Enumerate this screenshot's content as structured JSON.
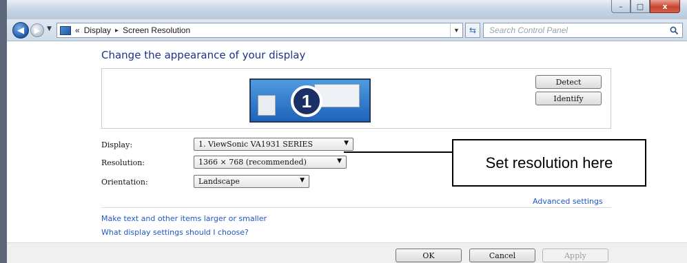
{
  "window": {
    "controls": {
      "minimize": "–",
      "maximize": "□",
      "close": "x"
    }
  },
  "nav": {
    "back_icon": "arrow-left-icon",
    "forward_icon": "arrow-right-icon",
    "breadcrumb_prefix": "«",
    "breadcrumb": [
      "Display",
      "Screen Resolution"
    ],
    "breadcrumb_separator": "▸",
    "search_placeholder": "Search Control Panel"
  },
  "page": {
    "title": "Change the appearance of your display",
    "monitor_number": "1",
    "detect_label": "Detect",
    "identify_label": "Identify"
  },
  "settings": {
    "display": {
      "label": "Display:",
      "value": "1. ViewSonic VA1931 SERIES"
    },
    "resolution": {
      "label": "Resolution:",
      "value": "1366 × 768 (recommended)"
    },
    "orientation": {
      "label": "Orientation:",
      "value": "Landscape"
    }
  },
  "callout": {
    "text": "Set resolution here"
  },
  "links": {
    "advanced": "Advanced settings",
    "text_size": "Make text and other items larger or smaller",
    "which_settings": "What display settings should I choose?"
  },
  "buttons": {
    "ok": "OK",
    "cancel": "Cancel",
    "apply": "Apply"
  },
  "colors": {
    "link": "#1f56c9",
    "title": "#1e3287",
    "close": "#c8442c"
  }
}
